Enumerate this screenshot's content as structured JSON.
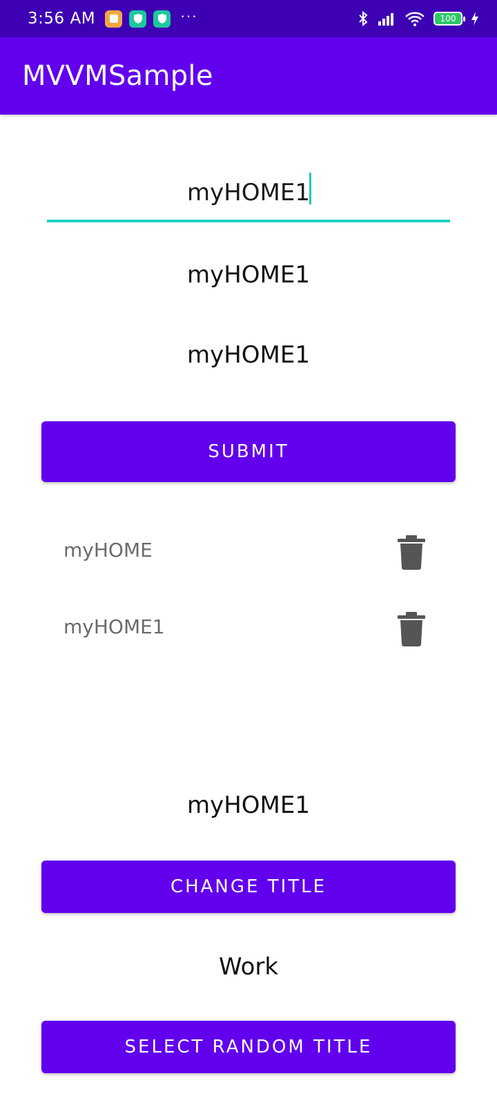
{
  "status_bar": {
    "time": "3:56 AM",
    "more": "···",
    "battery": "100",
    "icons": [
      "notification-orange-icon",
      "notification-shield-icon",
      "notification-shield-icon",
      "bluetooth-icon",
      "signal-icon",
      "wifi-icon",
      "battery-icon",
      "charging-icon"
    ]
  },
  "app_bar": {
    "title": "MVVMSample"
  },
  "form": {
    "input_value": "myHOME1",
    "bound_text_1": "myHOME1",
    "bound_text_2": "myHOME1",
    "submit_label": "SUBMIT"
  },
  "list": {
    "items": [
      {
        "label": "myHOME",
        "icon": "trash-icon"
      },
      {
        "label": "myHOME1",
        "icon": "trash-icon"
      }
    ]
  },
  "title_section": {
    "current_title": "myHOME1",
    "change_title_label": "CHANGE TITLE",
    "random_title": "Work",
    "select_random_label": "SELECT RANDOM TITLE"
  },
  "colors": {
    "status_bar": "#3d00b3",
    "primary": "#6200ee",
    "accent": "#1fd0c0"
  }
}
